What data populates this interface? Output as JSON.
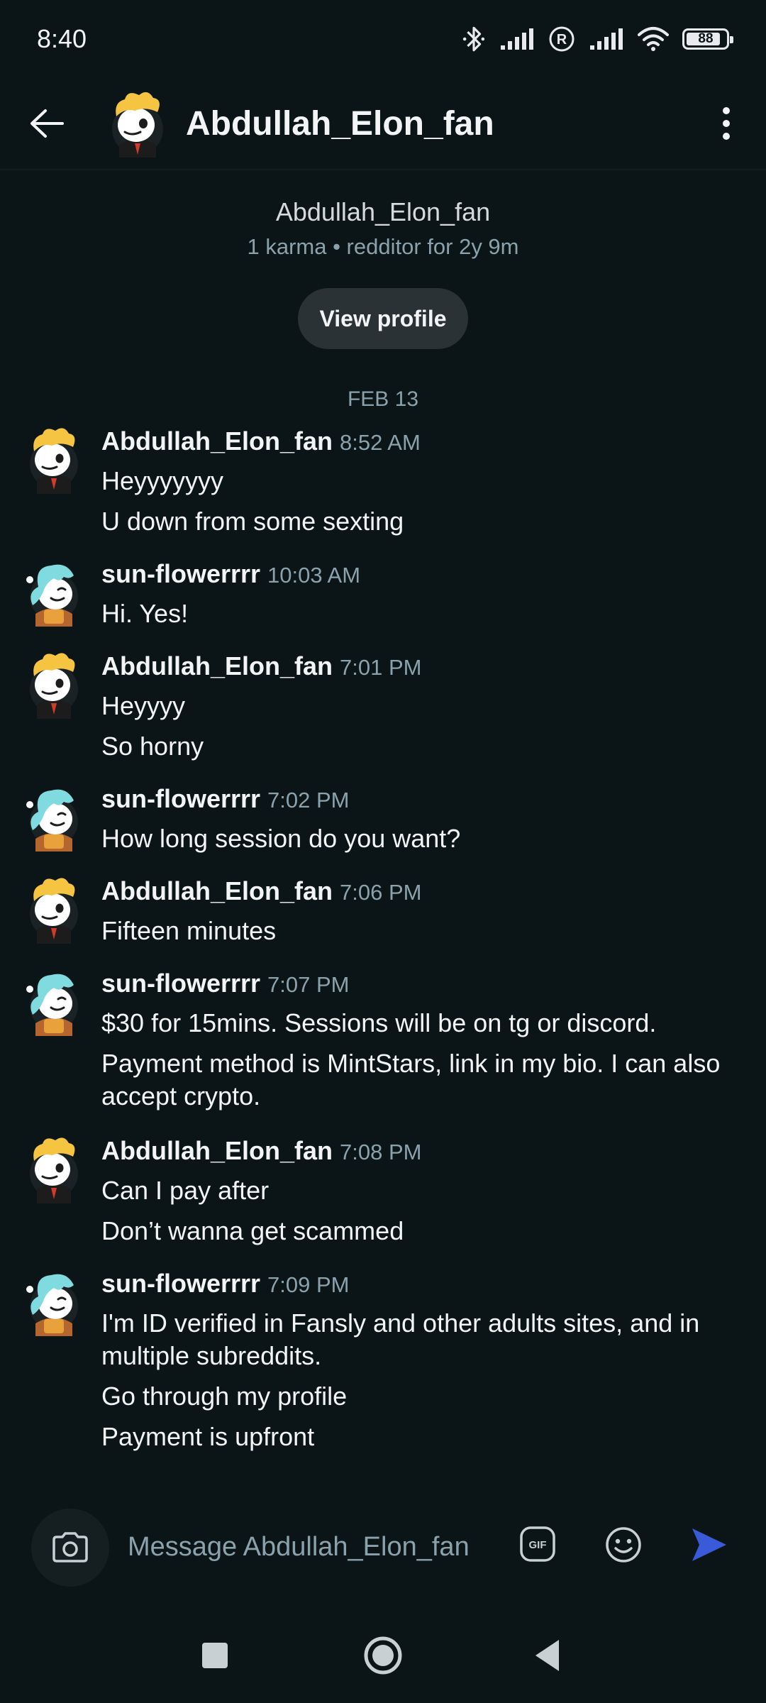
{
  "status_bar": {
    "time": "8:40",
    "battery": "88"
  },
  "header": {
    "title": "Abdullah_Elon_fan"
  },
  "profile": {
    "name": "Abdullah_Elon_fan",
    "meta": "1 karma • redditor for 2y 9m",
    "view_profile_label": "View profile"
  },
  "date_divider": "FEB 13",
  "messages": [
    {
      "author": "Abdullah_Elon_fan",
      "time": "8:52 AM",
      "lines": [
        "Heyyyyyyy",
        "U down from some sexting"
      ]
    },
    {
      "author": "sun-flowerrrr",
      "time": "10:03 AM",
      "lines": [
        "Hi. Yes!"
      ]
    },
    {
      "author": "Abdullah_Elon_fan",
      "time": "7:01 PM",
      "lines": [
        "Heyyyy",
        "So horny"
      ]
    },
    {
      "author": "sun-flowerrrr",
      "time": "7:02 PM",
      "lines": [
        "How long session do you want?"
      ]
    },
    {
      "author": "Abdullah_Elon_fan",
      "time": "7:06 PM",
      "lines": [
        "Fifteen minutes"
      ]
    },
    {
      "author": "sun-flowerrrr",
      "time": "7:07 PM",
      "lines": [
        "$30 for 15mins. Sessions will be on tg or discord.",
        "Payment method is MintStars, link in my bio. I can also accept crypto."
      ]
    },
    {
      "author": "Abdullah_Elon_fan",
      "time": "7:08 PM",
      "lines": [
        "Can I pay after",
        "Don’t wanna get scammed"
      ]
    },
    {
      "author": "sun-flowerrrr",
      "time": "7:09 PM",
      "lines": [
        "I'm ID verified in Fansly and other adults sites, and in multiple subreddits.",
        "Go through my profile",
        "Payment is upfront"
      ]
    }
  ],
  "composer": {
    "placeholder": "Message Abdullah_Elon_fan",
    "gif_label": "GIF"
  },
  "colors": {
    "background": "#0b1416",
    "muted_text": "#8ba2ad",
    "send_accent": "#3a5bd9"
  }
}
